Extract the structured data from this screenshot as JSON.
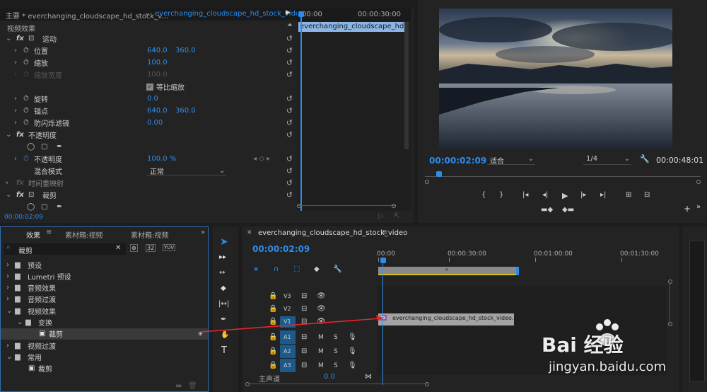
{
  "effect_controls": {
    "tab_main": "主要 * everchanging_cloudscape_hd_stock_v...",
    "tab_seq": "everchanging_cloudscape_hd_stock_video...",
    "section_label": "视频效果",
    "ruler_start": "00:00",
    "ruler_mid": "00:00:30:00",
    "clip_label": "everchanging_cloudscape_hd_stock_v",
    "timecode": "00:00:02:09",
    "rows": [
      {
        "label": "运动",
        "type": "group"
      },
      {
        "label": "位置",
        "v1": "640.0",
        "v2": "360.0"
      },
      {
        "label": "缩放",
        "v1": "100.0"
      },
      {
        "label": "缩放宽度",
        "v1": "100.0",
        "disabled": true
      },
      {
        "label": "等比缩放",
        "type": "check"
      },
      {
        "label": "旋转",
        "v1": "0.0"
      },
      {
        "label": "锚点",
        "v1": "640.0",
        "v2": "360.0"
      },
      {
        "label": "防闪烁滤镜",
        "v1": "0.00"
      },
      {
        "label": "不透明度",
        "type": "group"
      },
      {
        "label": "",
        "type": "masks"
      },
      {
        "label": "不透明度",
        "v1": "100.0 %",
        "keyframe": true
      },
      {
        "label": "混合模式",
        "dropdown": "正常"
      },
      {
        "label": "时间重映射",
        "type": "group-dim"
      },
      {
        "label": "裁剪",
        "type": "group"
      },
      {
        "label": "",
        "type": "masks"
      }
    ]
  },
  "program": {
    "timecode": "00:00:02:09",
    "fit": "适合",
    "quality": "1/4",
    "duration": "00:00:48:01"
  },
  "effects": {
    "tabs": [
      "效果",
      "素材箱:视频",
      "素材箱:视频"
    ],
    "search_value": "裁剪",
    "tree": [
      {
        "label": "预设",
        "depth": 0
      },
      {
        "label": "Lumetri 预设",
        "depth": 0
      },
      {
        "label": "音频效果",
        "depth": 0
      },
      {
        "label": "音频过渡",
        "depth": 0
      },
      {
        "label": "视频效果",
        "depth": 0,
        "open": true
      },
      {
        "label": "变换",
        "depth": 1,
        "open": true
      },
      {
        "label": "裁剪",
        "depth": 2,
        "selected": true,
        "effect": true
      },
      {
        "label": "视频过渡",
        "depth": 0
      },
      {
        "label": "常用",
        "depth": 0,
        "open": true
      },
      {
        "label": "裁剪",
        "depth": 1,
        "effect": true
      }
    ]
  },
  "timeline": {
    "sequence_name": "everchanging_cloudscape_hd_stock_video",
    "timecode": "00:00:02:09",
    "ruler": [
      "00:00",
      "00:00:30:00",
      "00:01:00:00",
      "00:01:30:00"
    ],
    "clip_name": "everchanging_cloudscape_hd_stock_video.mp4",
    "tracks": [
      {
        "name": "V3",
        "kind": "video"
      },
      {
        "name": "V2",
        "kind": "video"
      },
      {
        "name": "V1",
        "kind": "video",
        "active": true
      },
      {
        "name": "A1",
        "kind": "audio",
        "active": true
      },
      {
        "name": "A2",
        "kind": "audio",
        "active": true
      },
      {
        "name": "A3",
        "kind": "audio",
        "active": true
      }
    ],
    "master_label": "主声道",
    "master_value": "0.0",
    "mute": "M",
    "solo": "S"
  },
  "watermark": {
    "brand": "Bai 经验",
    "url": "jingyan.baidu.com"
  },
  "colors": {
    "accent": "#2d8ceb",
    "clip": "#a3a3a3",
    "panel": "#232323"
  }
}
